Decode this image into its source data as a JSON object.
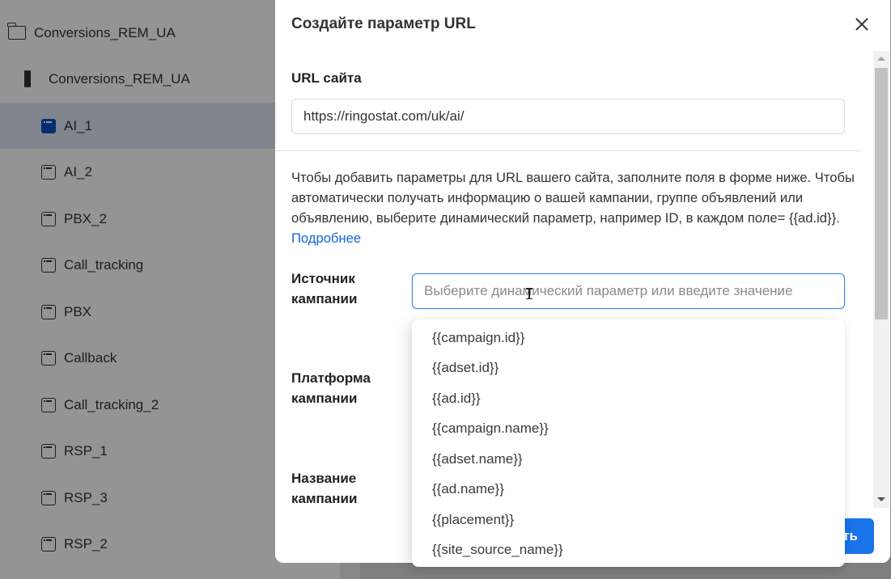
{
  "sidebar": {
    "items": [
      {
        "label": "Conversions_REM_UA",
        "icon": "folder-icon",
        "level": 0,
        "selected": false
      },
      {
        "label": "Conversions_REM_UA",
        "icon": "grid-icon",
        "level": 1,
        "selected": false
      },
      {
        "label": "AI_1",
        "icon": "page-icon",
        "level": 2,
        "selected": true
      },
      {
        "label": "AI_2",
        "icon": "page-icon",
        "level": 2,
        "selected": false
      },
      {
        "label": "PBX_2",
        "icon": "page-icon",
        "level": 2,
        "selected": false
      },
      {
        "label": "Call_tracking",
        "icon": "page-icon",
        "level": 2,
        "selected": false
      },
      {
        "label": "PBX",
        "icon": "page-icon",
        "level": 2,
        "selected": false
      },
      {
        "label": "Callback",
        "icon": "page-icon",
        "level": 2,
        "selected": false
      },
      {
        "label": "Call_tracking_2",
        "icon": "page-icon",
        "level": 2,
        "selected": false
      },
      {
        "label": "RSP_1",
        "icon": "page-icon",
        "level": 2,
        "selected": false
      },
      {
        "label": "RSP_3",
        "icon": "page-icon",
        "level": 2,
        "selected": false
      },
      {
        "label": "RSP_2",
        "icon": "page-icon",
        "level": 2,
        "selected": false
      }
    ]
  },
  "modal": {
    "title": "Создайте параметр URL",
    "close_icon": "close-icon",
    "url_label": "URL сайта",
    "url_value": "https://ringostat.com/uk/ai/",
    "help_text": "Чтобы добавить параметры для URL вашего сайта, заполните поля в форме ниже. Чтобы автоматически получать информацию о вашей кампании, группе объявлений или объявлению, выберите динамический параметр, например ID, в каждом поле= {{ad.id}}.",
    "help_link": "Подробнее",
    "fields": {
      "source_label": "Источник кампании",
      "platform_label": "Платформа кампании",
      "name_label": "Название кампании"
    },
    "source_placeholder": "Выберите динамический параметр или введите значение",
    "submit_label_visible": "ть",
    "dropdown_options": [
      "{{campaign.id}}",
      "{{adset.id}}",
      "{{ad.id}}",
      "{{campaign.name}}",
      "{{adset.name}}",
      "{{ad.name}}",
      "{{placement}}",
      "{{site_source_name}}"
    ]
  },
  "colors": {
    "accent": "#1a73e8",
    "link": "#1565d8",
    "focus_border": "#3b82e8",
    "selected_icon": "#0a4fc9",
    "selected_row": "#dde5f4"
  }
}
